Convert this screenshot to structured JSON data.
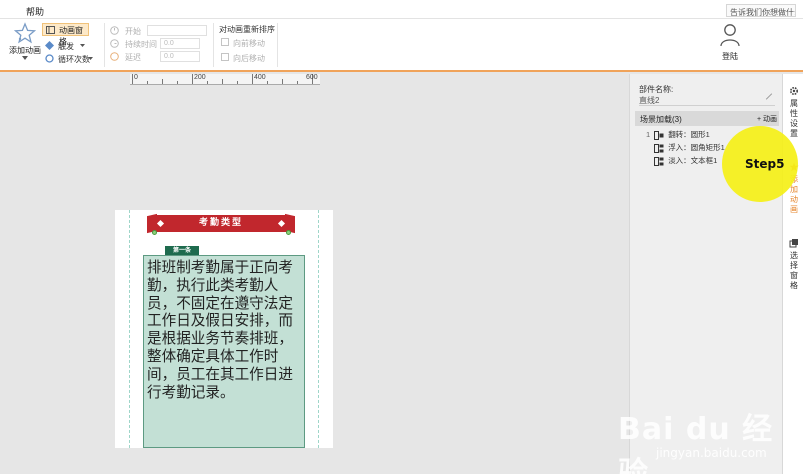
{
  "menubar": {
    "help": "帮助",
    "tellme": "告诉我们你想做什么？"
  },
  "ribbon": {
    "add_animation": "添加动画",
    "animation_pane": "动画窗格",
    "trigger": "触发",
    "loop_count": "循环次数",
    "start_label": "开始",
    "duration_label": "持续时间",
    "duration_value": "0.0",
    "delay_label": "延迟",
    "delay_value": "0.0",
    "reorder_title": "对动画重新排序",
    "move_earlier": "向前移动",
    "move_later": "向后移动",
    "login": "登陆"
  },
  "ruler": {
    "labels": [
      "0",
      "200",
      "400",
      "600"
    ]
  },
  "slide": {
    "title": "考勤类型",
    "tag": "第一条",
    "body": "排班制考勤属于正向考勤，执行此类考勤人员，不固定在遵守法定工作日及假日安排，而是根据业务节奏排班，整体确定具体工作时间，员工在其工作日进行考勤记录。"
  },
  "pane": {
    "component_name_label": "部件名称:",
    "component_name_value": "直线2",
    "scene_title": "场景加载(3)",
    "add_animation": "+ 动画",
    "animations": [
      {
        "index": "1",
        "text": "翻转：圆形1"
      },
      {
        "index": "",
        "text": "浮入：圆角矩形1"
      },
      {
        "index": "",
        "text": "淡入：文本框1"
      }
    ]
  },
  "sidetabs": {
    "properties": "属性设置",
    "animation": "添加动画",
    "selection": "选择窗格"
  },
  "annotation": {
    "step": "Step5"
  },
  "watermark": {
    "logo": "Bai du 经验",
    "url": "jingyan.baidu.com"
  },
  "colors": {
    "accent_orange": "#e5852c",
    "banner_red": "#c1272d",
    "tag_green": "#1e6b4e",
    "textbox_fill": "#c3e0d5",
    "highlight_yellow": "#f5f017"
  }
}
